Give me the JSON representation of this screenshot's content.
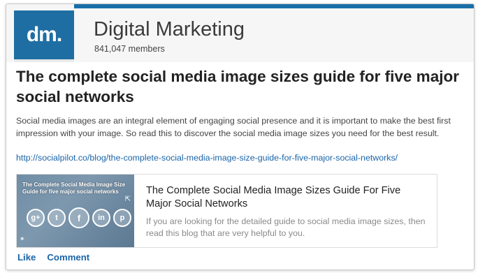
{
  "group": {
    "logo_text": "dm.",
    "name": "Digital Marketing",
    "members": "841,047 members"
  },
  "post": {
    "title": "The complete social media image sizes guide for five major social networks",
    "body": "Social media images are an integral element of engaging social presence and it is important to make the best first impression with your image. So read this to discover the social media image sizes you need for the best result.",
    "link": "http://socialpilot.co/blog/the-complete-social-media-image-size-guide-for-five-major-social-networks/"
  },
  "preview": {
    "thumb_title": "The Complete Social Media Image Size Guide for five major social networks",
    "thumb_icons": [
      "g+",
      "t",
      "f",
      "in",
      "p"
    ],
    "title": "The Complete Social Media Image Sizes Guide For Five Major Social Networks",
    "description": "If you are looking for the detailed guide to social media image sizes, then read this blog that are very helpful to you."
  },
  "actions": {
    "like": "Like",
    "comment": "Comment"
  },
  "colors": {
    "accent": "#1a6fa8",
    "link": "#1a64a8",
    "logo_bg": "#1f6ea3"
  }
}
